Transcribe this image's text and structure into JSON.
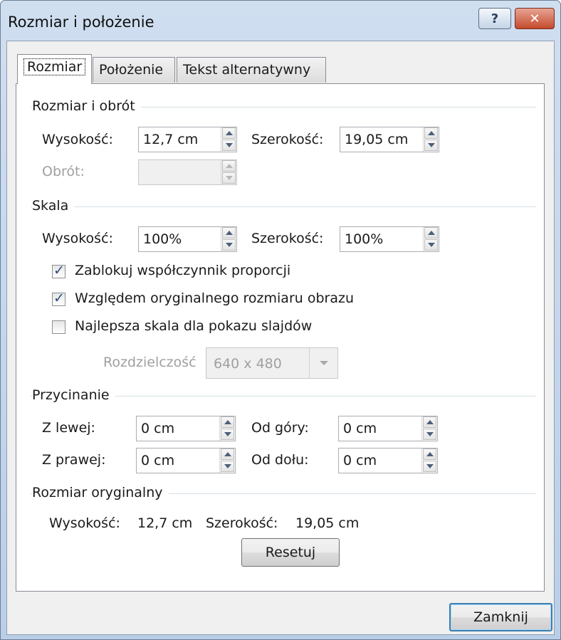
{
  "window": {
    "title": "Rozmiar i położenie",
    "help_glyph": "?",
    "close_glyph": "✕"
  },
  "tabs": [
    {
      "label": "Rozmiar"
    },
    {
      "label": "Położenie"
    },
    {
      "label": "Tekst alternatywny"
    }
  ],
  "size_rotate": {
    "group": "Rozmiar i obrót",
    "height_label": "Wysokość:",
    "height_value": "12,7 cm",
    "width_label": "Szerokość:",
    "width_value": "19,05 cm",
    "rotation_label": "Obrót:",
    "rotation_value": ""
  },
  "scale": {
    "group": "Skala",
    "height_label": "Wysokość:",
    "height_value": "100%",
    "width_label": "Szerokość:",
    "width_value": "100%",
    "lock_aspect": {
      "label": "Zablokuj współczynnik proporcji",
      "checked": true
    },
    "relative_original": {
      "label": "Względem oryginalnego rozmiaru obrazu",
      "checked": true
    },
    "best_scale": {
      "label": "Najlepsza skala dla pokazu slajdów",
      "checked": false
    },
    "resolution_label": "Rozdzielczość",
    "resolution_value": "640 x 480"
  },
  "crop": {
    "group": "Przycinanie",
    "left_label": "Z lewej:",
    "left_value": "0 cm",
    "top_label": "Od góry:",
    "top_value": "0 cm",
    "right_label": "Z prawej:",
    "right_value": "0 cm",
    "bottom_label": "Od dołu:",
    "bottom_value": "0 cm"
  },
  "original": {
    "group": "Rozmiar oryginalny",
    "height_label": "Wysokość:",
    "height_value": "12,7 cm",
    "width_label": "Szerokość:",
    "width_value": "19,05 cm",
    "reset_label": "Resetuj"
  },
  "footer": {
    "close_label": "Zamknij"
  }
}
